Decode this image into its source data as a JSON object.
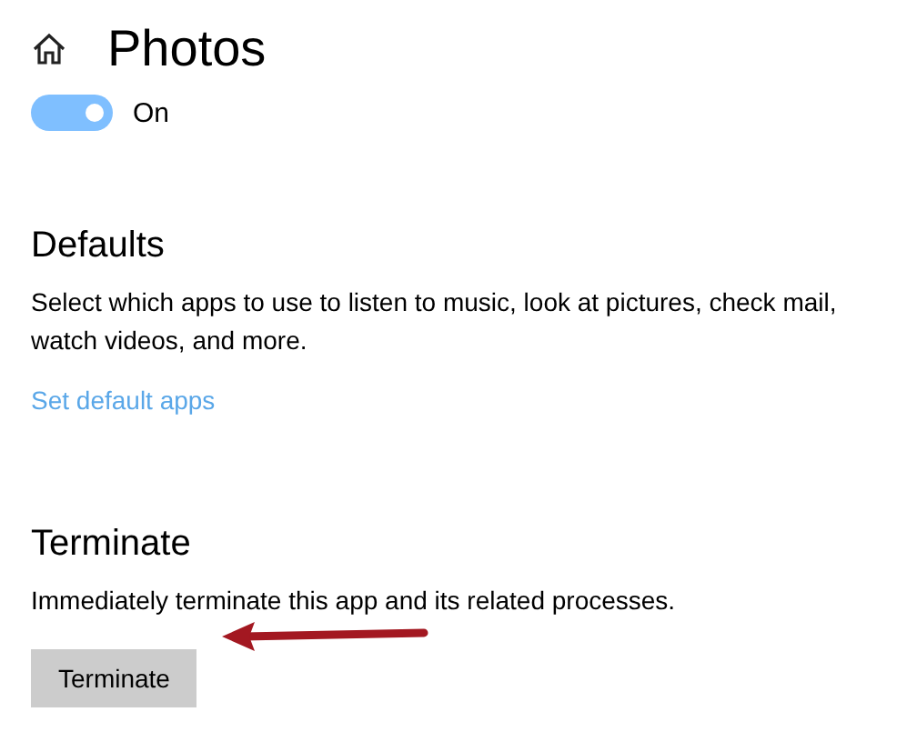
{
  "header": {
    "title": "Photos"
  },
  "toggle": {
    "on": true,
    "label": "On"
  },
  "sections": [
    {
      "heading": "Defaults",
      "description": "Select which apps to use to listen to music, look at pictures, check mail, watch videos, and more.",
      "link": "Set default apps"
    },
    {
      "heading": "Terminate",
      "description": "Immediately terminate this app and its related processes.",
      "button": "Terminate"
    }
  ]
}
